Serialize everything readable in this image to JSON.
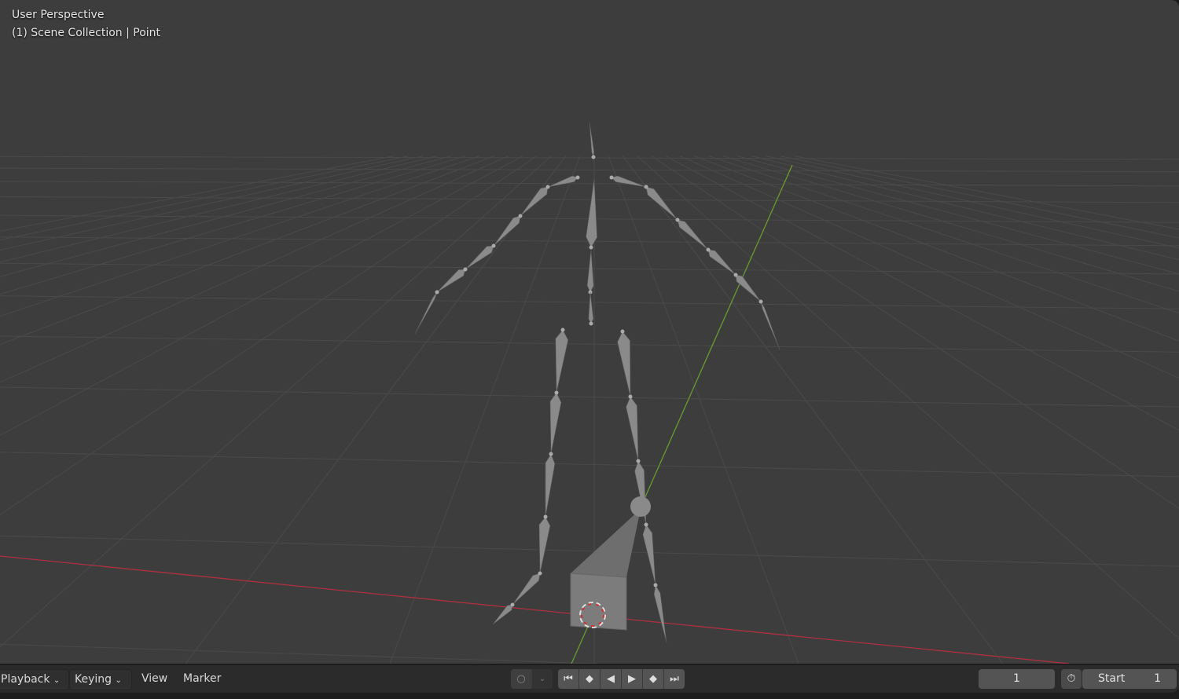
{
  "viewport": {
    "perspective_label": "User Perspective",
    "collection_label": "(1) Scene Collection | Point"
  },
  "timeline": {
    "menus": [
      {
        "label": "Playback",
        "dropdown": true
      },
      {
        "label": "Keying",
        "dropdown": true
      },
      {
        "label": "View"
      },
      {
        "label": "Marker"
      }
    ],
    "keying_icon": "record-circle-icon",
    "transport": [
      {
        "name": "jump-to-start",
        "glyph": "⏮"
      },
      {
        "name": "jump-to-prev-keyframe",
        "glyph": "◆"
      },
      {
        "name": "play-reverse",
        "glyph": "◀"
      },
      {
        "name": "play",
        "glyph": "▶"
      },
      {
        "name": "jump-to-next-keyframe",
        "glyph": "◆"
      },
      {
        "name": "jump-to-end",
        "glyph": "⏭"
      }
    ],
    "current_frame": "1",
    "start_label": "Start",
    "start_value": "1"
  },
  "colors": {
    "x_axis": "#b03040",
    "y_axis": "#6a9a30",
    "bone": "#8a8a8a"
  }
}
